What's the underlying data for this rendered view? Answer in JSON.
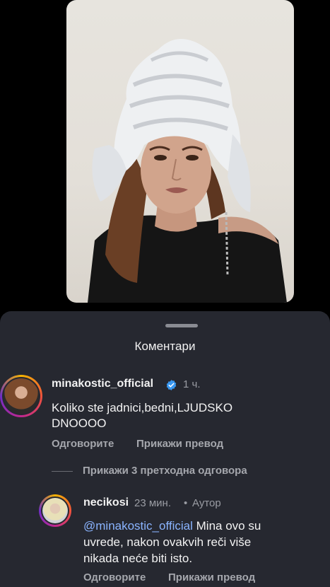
{
  "sheet": {
    "title": "Коментари"
  },
  "comments": [
    {
      "username": "minakostic_official",
      "time": "1 ч.",
      "text_line1": "Koliko ste jadnici,bedni,LJUDSKO",
      "text_line2": "DNOOOO",
      "reply_label": "Одговорите",
      "translate_label": "Прикажи превод"
    }
  ],
  "show_replies": "Прикажи 3 претходна одговора",
  "reply": {
    "username": "necikosi",
    "time": "23 мин.",
    "separator": "•",
    "author_label": "Аутор",
    "mention": "@minakostic_official",
    "text_line1_rest": " Mina ovo su",
    "text_line2": "uvrede, nakon ovakvih reči više",
    "text_line3": "nikada neće biti isto.",
    "reply_label": "Одговорите",
    "translate_label": "Прикажи превод"
  },
  "colors": {
    "sheet_bg": "#262830",
    "mention": "#8ab4ff",
    "verified": "#3897f0"
  }
}
